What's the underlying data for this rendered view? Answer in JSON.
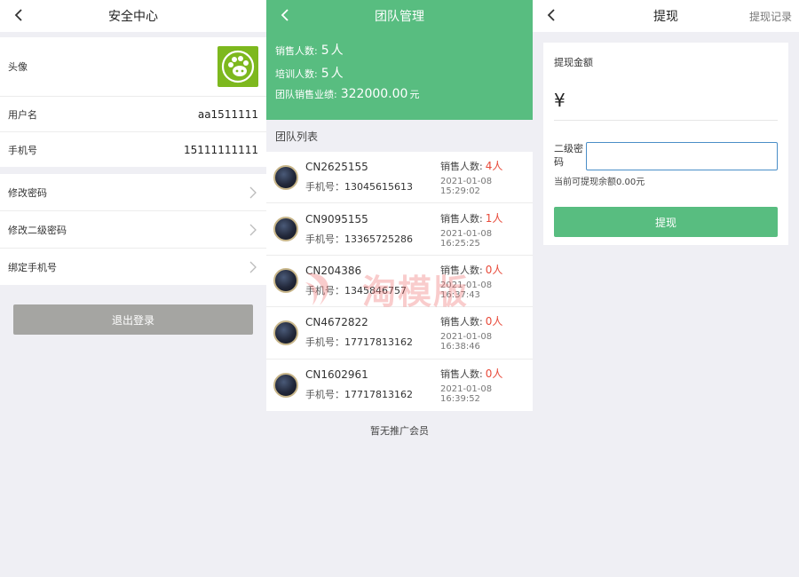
{
  "security": {
    "title": "安全中心",
    "avatar_label": "头像",
    "username_label": "用户名",
    "username_value": "aa1511111",
    "phone_label": "手机号",
    "phone_value": "15111111111",
    "change_password": "修改密码",
    "change_secondary_password": "修改二级密码",
    "bind_phone": "绑定手机号",
    "logout": "退出登录",
    "avatar_color": "#7db81e"
  },
  "team": {
    "title": "团队管理",
    "sales_count_label": "销售人数:",
    "sales_count_value": "5",
    "training_count_label": "培训人数:",
    "training_count_value": "5",
    "team_sales_label": "团队销售业绩:",
    "team_sales_value": "322000.00",
    "unit_person": "人",
    "unit_yuan": "元",
    "list_title": "团队列表",
    "phone_prefix": "手机号：",
    "sales_prefix": "销售人数:",
    "members": [
      {
        "id": "CN2625155",
        "phone": "13045615613",
        "sales": "4人",
        "time": "2021-01-08 15:29:02"
      },
      {
        "id": "CN9095155",
        "phone": "13365725286",
        "sales": "1人",
        "time": "2021-01-08 16:25:25"
      },
      {
        "id": "CN204386",
        "phone": "1345846757",
        "sales": "0人",
        "time": "2021-01-08 16:37:43"
      },
      {
        "id": "CN4672822",
        "phone": "17717813162",
        "sales": "0人",
        "time": "2021-01-08 16:38:46"
      },
      {
        "id": "CN1602961",
        "phone": "17717813162",
        "sales": "0人",
        "time": "2021-01-08 16:39:52"
      }
    ],
    "no_more": "暂无推广会员",
    "watermark": "淘模版",
    "accent_color": "#58bd80",
    "count_color": "#e84a3a"
  },
  "withdraw": {
    "title": "提现",
    "records_link": "提现记录",
    "amount_label": "提现金额",
    "currency_symbol": "¥",
    "secondary_password_label": "二级密码",
    "balance_text": "当前可提现余额0.00元",
    "submit": "提现"
  }
}
